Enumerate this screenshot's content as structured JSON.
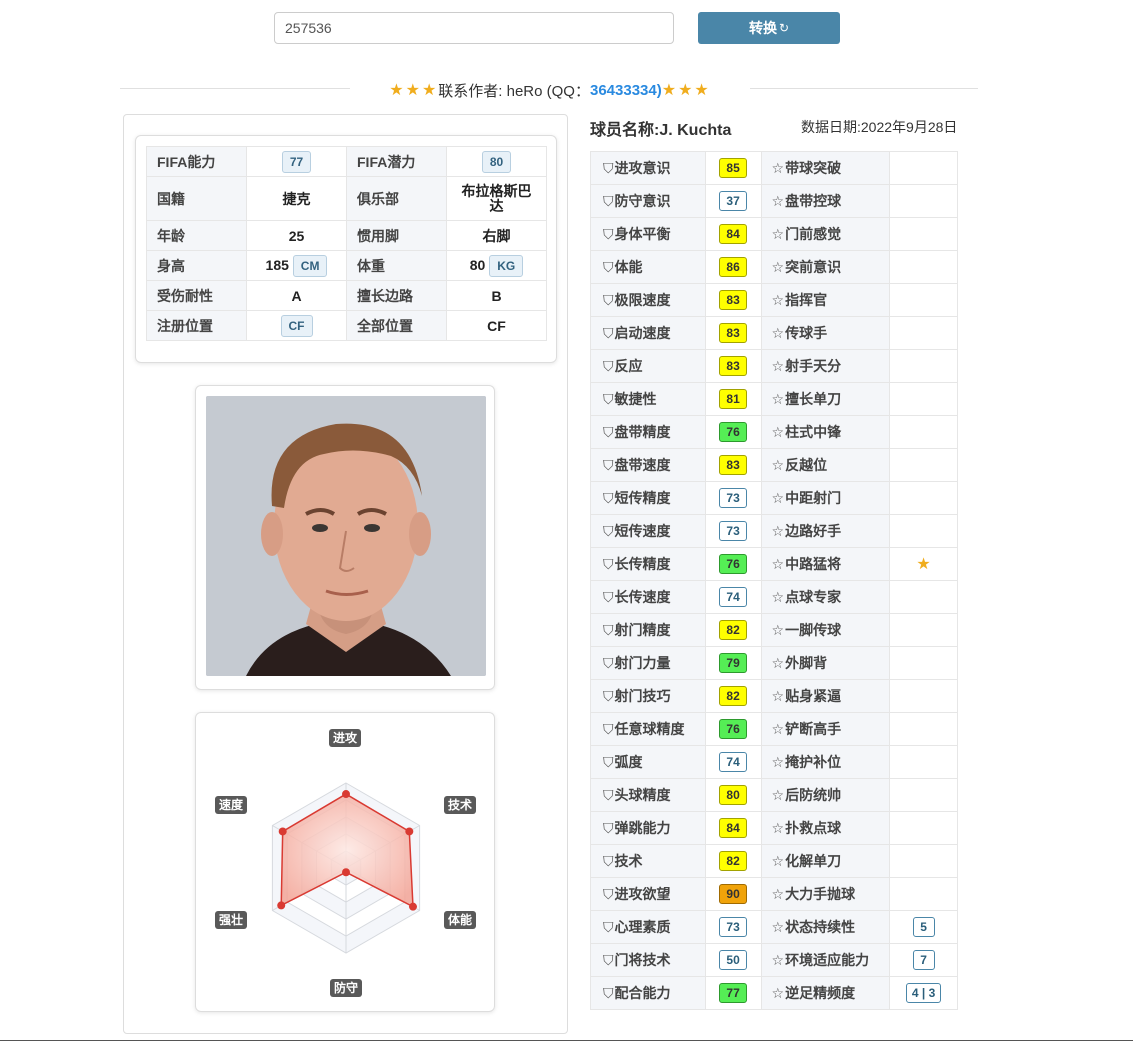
{
  "search": {
    "value": "257536"
  },
  "convert_button": {
    "label": "转换",
    "icon": "refresh-icon"
  },
  "author": {
    "prefix": "联系作者: heRo (QQ：",
    "qq": "36433334)",
    "stars": "★★★"
  },
  "info": {
    "fifa_ability_label": "FIFA能力",
    "fifa_ability": "77",
    "fifa_potential_label": "FIFA潜力",
    "fifa_potential": "80",
    "nationality_label": "国籍",
    "nationality": "捷克",
    "club_label": "俱乐部",
    "club": "布拉格斯巴达",
    "age_label": "年龄",
    "age": "25",
    "foot_label": "惯用脚",
    "foot": "右脚",
    "height_label": "身高",
    "height": "185",
    "height_unit": "CM",
    "weight_label": "体重",
    "weight": "80",
    "weight_unit": "KG",
    "injury_label": "受伤耐性",
    "injury": "A",
    "side_label": "擅长边路",
    "side": "B",
    "reg_pos_label": "注册位置",
    "reg_pos": "CF",
    "all_pos_label": "全部位置",
    "all_pos": "CF"
  },
  "radar": {
    "labels": {
      "attack": "进攻",
      "technique": "技术",
      "physical": "体能",
      "defense": "防守",
      "strength": "强壮",
      "speed": "速度"
    },
    "values": {
      "attack": 0.87,
      "technique": 0.86,
      "physical": 0.91,
      "defense": 0.05,
      "strength": 0.88,
      "speed": 0.86
    }
  },
  "player": {
    "name_label": "球员名称:J. Kuchta",
    "date_label": "数据日期:2022年9月28日"
  },
  "colors": {
    "yellow": "#ffff00",
    "green": "#55ee55",
    "orange": "#f0a30a",
    "button": "#4a86a8",
    "star": "#f0ad1e"
  },
  "attributes": [
    {
      "name": "进攻意识",
      "value": "85",
      "color": "yellow",
      "skill": "带球突破",
      "skill_value": ""
    },
    {
      "name": "防守意识",
      "value": "37",
      "color": "white",
      "skill": "盘带控球",
      "skill_value": ""
    },
    {
      "name": "身体平衡",
      "value": "84",
      "color": "yellow",
      "skill": "门前感觉",
      "skill_value": ""
    },
    {
      "name": "体能",
      "value": "86",
      "color": "yellow",
      "skill": "突前意识",
      "skill_value": ""
    },
    {
      "name": "极限速度",
      "value": "83",
      "color": "yellow",
      "skill": "指挥官",
      "skill_value": ""
    },
    {
      "name": "启动速度",
      "value": "83",
      "color": "yellow",
      "skill": "传球手",
      "skill_value": ""
    },
    {
      "name": "反应",
      "value": "83",
      "color": "yellow",
      "skill": "射手天分",
      "skill_value": ""
    },
    {
      "name": "敏捷性",
      "value": "81",
      "color": "yellow",
      "skill": "擅长单刀",
      "skill_value": ""
    },
    {
      "name": "盘带精度",
      "value": "76",
      "color": "green",
      "skill": "柱式中锋",
      "skill_value": ""
    },
    {
      "name": "盘带速度",
      "value": "83",
      "color": "yellow",
      "skill": "反越位",
      "skill_value": ""
    },
    {
      "name": "短传精度",
      "value": "73",
      "color": "white",
      "skill": "中距射门",
      "skill_value": ""
    },
    {
      "name": "短传速度",
      "value": "73",
      "color": "white",
      "skill": "边路好手",
      "skill_value": ""
    },
    {
      "name": "长传精度",
      "value": "76",
      "color": "green",
      "skill": "中路猛将",
      "skill_value": "star"
    },
    {
      "name": "长传速度",
      "value": "74",
      "color": "white",
      "skill": "点球专家",
      "skill_value": ""
    },
    {
      "name": "射门精度",
      "value": "82",
      "color": "yellow",
      "skill": "一脚传球",
      "skill_value": ""
    },
    {
      "name": "射门力量",
      "value": "79",
      "color": "green",
      "skill": "外脚背",
      "skill_value": ""
    },
    {
      "name": "射门技巧",
      "value": "82",
      "color": "yellow",
      "skill": "贴身紧逼",
      "skill_value": ""
    },
    {
      "name": "任意球精度",
      "value": "76",
      "color": "green",
      "skill": "铲断高手",
      "skill_value": ""
    },
    {
      "name": "弧度",
      "value": "74",
      "color": "white",
      "skill": "掩护补位",
      "skill_value": ""
    },
    {
      "name": "头球精度",
      "value": "80",
      "color": "yellow",
      "skill": "后防统帅",
      "skill_value": ""
    },
    {
      "name": "弹跳能力",
      "value": "84",
      "color": "yellow",
      "skill": "扑救点球",
      "skill_value": ""
    },
    {
      "name": "技术",
      "value": "82",
      "color": "yellow",
      "skill": "化解单刀",
      "skill_value": ""
    },
    {
      "name": "进攻欲望",
      "value": "90",
      "color": "orange",
      "skill": "大力手抛球",
      "skill_value": ""
    },
    {
      "name": "心理素质",
      "value": "73",
      "color": "white",
      "skill": "状态持续性",
      "skill_value": "5"
    },
    {
      "name": "门将技术",
      "value": "50",
      "color": "white",
      "skill": "环境适应能力",
      "skill_value": "7"
    },
    {
      "name": "配合能力",
      "value": "77",
      "color": "green",
      "skill": "逆足精频度",
      "skill_value": "4 | 3"
    }
  ]
}
